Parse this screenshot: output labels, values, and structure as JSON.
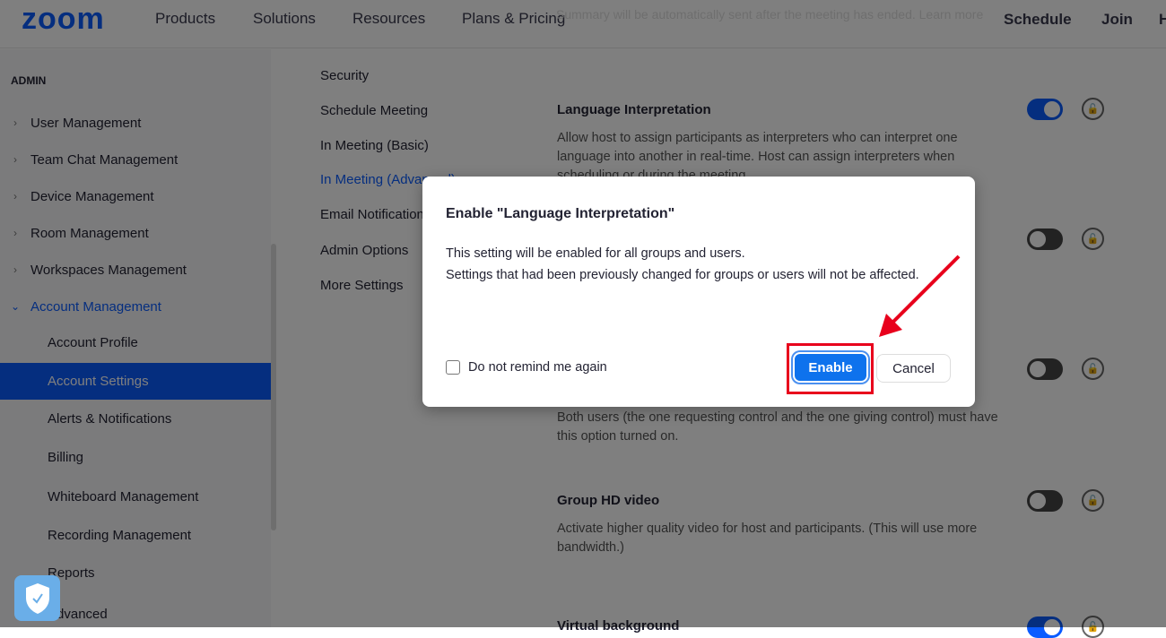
{
  "header": {
    "logo": "zoom",
    "nav": [
      "Products",
      "Solutions",
      "Resources",
      "Plans & Pricing"
    ],
    "right": [
      "Schedule",
      "Join",
      "H"
    ],
    "background_text": "Summary will be automatically sent after the meeting has ended. Learn more"
  },
  "sidebar": {
    "section": "ADMIN",
    "items": [
      "User Management",
      "Team Chat Management",
      "Device Management",
      "Room Management",
      "Workspaces Management",
      "Account Management"
    ],
    "sub_items": [
      "Account Profile",
      "Account Settings",
      "Alerts & Notifications",
      "Billing",
      "Whiteboard Management",
      "Recording Management",
      "Reports",
      "Advanced"
    ],
    "active": "Account Settings"
  },
  "subnav": [
    "Security",
    "Schedule Meeting",
    "In Meeting (Basic)",
    "In Meeting (Advanced)",
    "Email Notification",
    "Admin Options",
    "More Settings"
  ],
  "settings": [
    {
      "title": "Language Interpretation",
      "desc": "Allow host to assign participants as interpreters who can interpret one language into another in real-time. Host can assign interpreters when scheduling or during the meeting.",
      "enabled": true
    },
    {
      "title": "",
      "desc": "Both users (the one requesting control and the one giving control) must have this option turned on.",
      "enabled": false
    },
    {
      "title": "Group HD video",
      "desc": "Activate higher quality video for host and participants. (This will use more bandwidth.)",
      "enabled": false
    },
    {
      "title": "Virtual background",
      "desc": "",
      "enabled": true
    }
  ],
  "dialog": {
    "title": "Enable \"Language Interpretation\"",
    "line1": "This setting will be enabled for all groups and users.",
    "line2": "Settings that had been previously changed for groups or users will not be affected.",
    "checkbox": "Do not remind me again",
    "checkbox_checked": false,
    "enable": "Enable",
    "cancel": "Cancel"
  },
  "colors": {
    "brand": "#0b5cff",
    "enable_button": "#0e72ed",
    "annotation": "#e8001c"
  }
}
